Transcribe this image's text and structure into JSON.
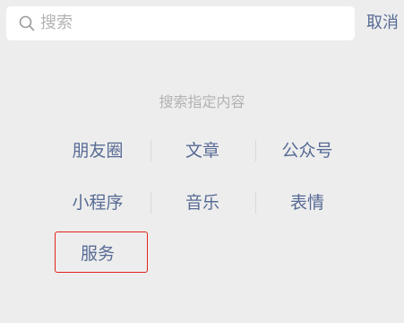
{
  "search": {
    "placeholder": "搜索",
    "cancel_label": "取消"
  },
  "section": {
    "title": "搜索指定内容"
  },
  "categories": [
    {
      "label": "朋友圈"
    },
    {
      "label": "文章"
    },
    {
      "label": "公众号"
    },
    {
      "label": "小程序"
    },
    {
      "label": "音乐"
    },
    {
      "label": "表情"
    },
    {
      "label": "服务"
    }
  ],
  "colors": {
    "background": "#ededed",
    "link": "#576b95",
    "muted": "#b2b2b2",
    "highlight_border": "#e2231a"
  }
}
